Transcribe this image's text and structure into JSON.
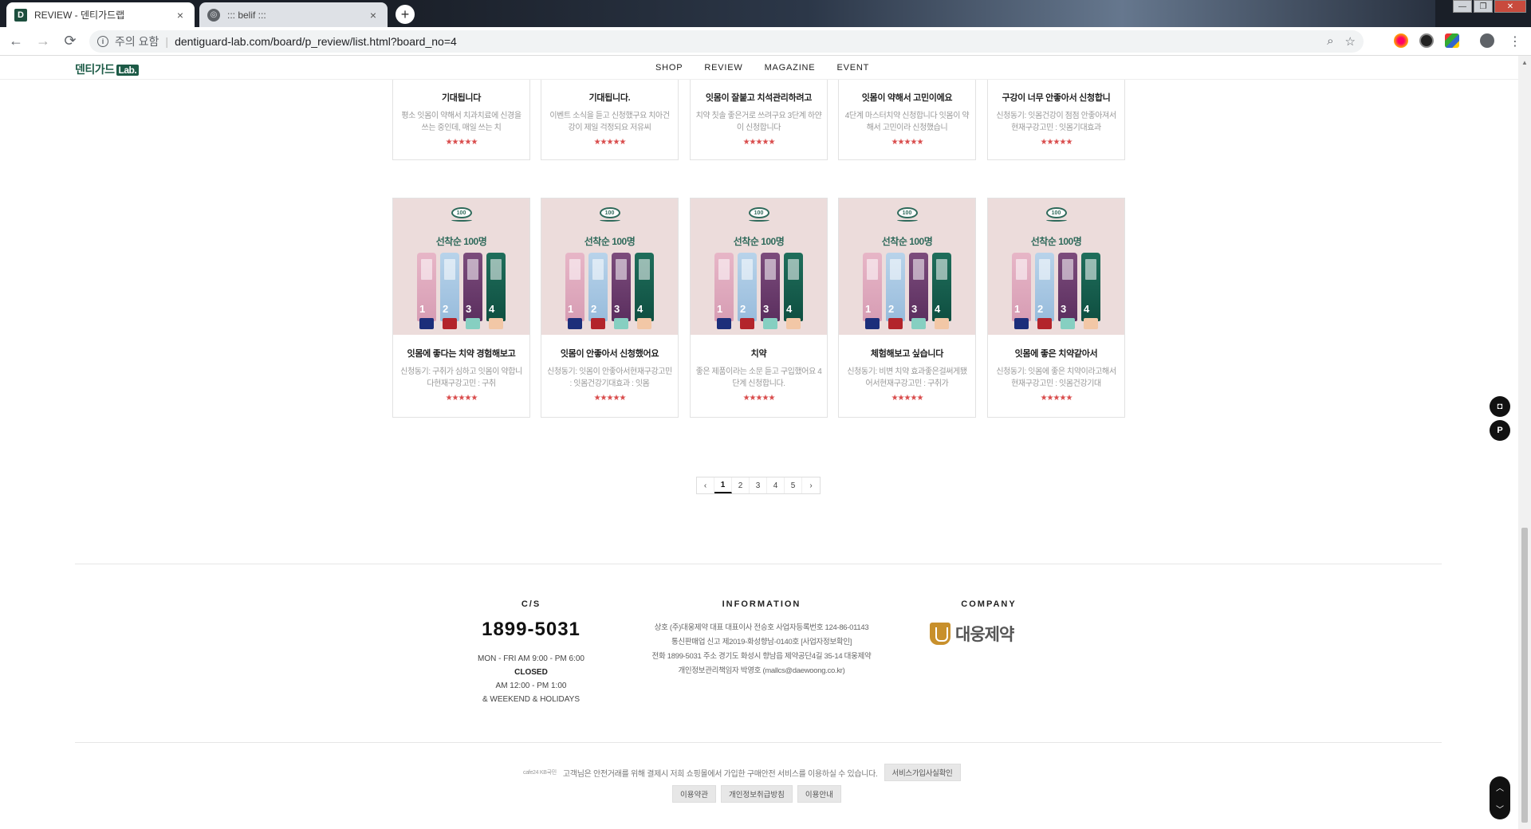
{
  "browser": {
    "tabs": [
      {
        "favicon": "D",
        "title": "REVIEW - 덴티가드랩",
        "close": "×"
      },
      {
        "favicon": "◎",
        "title": "::: belif :::",
        "close": "×"
      }
    ],
    "new_tab": "+",
    "window_controls": {
      "minimize": "—",
      "maximize": "❐",
      "close": "✕"
    },
    "nav": {
      "back": "←",
      "forward": "→",
      "reload": "⟳"
    },
    "address": {
      "info_icon": "i",
      "security_text": "주의 요함",
      "separator": "|",
      "url": "dentiguard-lab.com/board/p_review/list.html?board_no=4"
    },
    "toolbar_icons": {
      "zoom": "⌕",
      "bookmark": "☆",
      "profile": "●",
      "menu": "⋮"
    }
  },
  "site": {
    "logo_text": "덴티가드",
    "logo_badge": "Lab.",
    "nav": [
      "SHOP",
      "REVIEW",
      "MAGAZINE",
      "EVENT"
    ]
  },
  "top_row": [
    {
      "title": "기대됩니다",
      "desc": "평소 잇몸이 약해서 치과치료에 신경을 쓰는 중인데, 매일 쓰는 치",
      "stars": "★★★★★"
    },
    {
      "title": "기대됩니다.",
      "desc": "이벤트 소식을 듣고 신청했구요 치아건강이 제일 걱정되요 저유씨",
      "stars": "★★★★★"
    },
    {
      "title": "잇몸이 잘붙고 치석관리하려고",
      "desc": "치약 칫솔 좋은거로 쓰려구요 3단계 하얀이 신청합니다",
      "stars": "★★★★★"
    },
    {
      "title": "잇몸이 약해서 고민이에요",
      "desc": "4단계 마스터치약 신청합니다 잇몸이 약해서 고민이라 신청했습니",
      "stars": "★★★★★"
    },
    {
      "title": "구강이 너무 안좋아서 신청합니",
      "desc": "신청동기: 잇몸건강이 점점 안좋아져서현재구강고민 : 잇몸기대효과",
      "stars": "★★★★★"
    }
  ],
  "bottom_row": [
    {
      "promo": "선착순 100명",
      "badge": "100",
      "title": "잇몸에 좋다는 치약 경험해보고",
      "desc": "신청동기: 구취가 심하고 잇몸이 약합니다현재구강고민 : 구취",
      "stars": "★★★★★"
    },
    {
      "promo": "선착순 100명",
      "badge": "100",
      "title": "잇몸이 안좋아서 신청했어요",
      "desc": "신청동기: 잇몸이 안좋아서현재구강고민 : 잇몸건강기대효과 : 잇몸",
      "stars": "★★★★★"
    },
    {
      "promo": "선착순 100명",
      "badge": "100",
      "title": "치약",
      "desc": "좋은 제품이라는 소문 듣고 구입했어요 4단계 신청합니다.",
      "stars": "★★★★★"
    },
    {
      "promo": "선착순 100명",
      "badge": "100",
      "title": "체험해보고 싶습니다",
      "desc": "신청동기: 비변 치약 효과좋은걸써게됐어서현재구강고민 : 구취가",
      "stars": "★★★★★"
    },
    {
      "promo": "선착순 100명",
      "badge": "100",
      "title": "잇몸에 좋은 치약같아서",
      "desc": "신청동기: 잇몸에 좋은 치약이라고해서현재구강고민 : 잇몸건강기대",
      "stars": "★★★★★"
    }
  ],
  "tube_numbers": [
    "1",
    "2",
    "3",
    "4"
  ],
  "pagination": {
    "prev": "‹",
    "pages": [
      "1",
      "2",
      "3",
      "4",
      "5"
    ],
    "current": "1",
    "next": "›"
  },
  "footer": {
    "cs_title": "C/S",
    "phone": "1899-5031",
    "hours_line1": "MON - FRI AM 9:00 - PM 6:00",
    "closed_label": "CLOSED",
    "hours_line2": "AM 12:00 - PM 1:00",
    "hours_line3": "& WEEKEND & HOLIDAYS",
    "info_title": "INFORMATION",
    "info_line1": "상호 (주)대웅제약   대표 대표이사 전승호   사업자등록번호 124-86-01143",
    "info_line2": "통신판매업 신고 제2019-화성향남-0140호   [사업자정보확인]",
    "info_line3": "전화 1899-5031   주소 경기도 화성시 향남읍 제약공단4길 35-14 대웅제약",
    "info_line4": "개인정보관리책임자 박영호 (mallcs@daewoong.co.kr)",
    "company_title": "COMPANY",
    "company_name": "대웅제약",
    "pay_logos": "cafe24  KB국민",
    "notice": "고객님은 안전거래를 위해 결제시 저희 쇼핑몰에서 가입한 구매안전 서비스를 이용하실 수 있습니다.",
    "service_btn": "서비스가입사실확인",
    "links": [
      "이용약관",
      "개인정보취급방침",
      "이용안내"
    ]
  },
  "floating": {
    "btn1": "◘",
    "btn2": "P",
    "scroll_up": "︿",
    "scroll_down": "﹀"
  }
}
